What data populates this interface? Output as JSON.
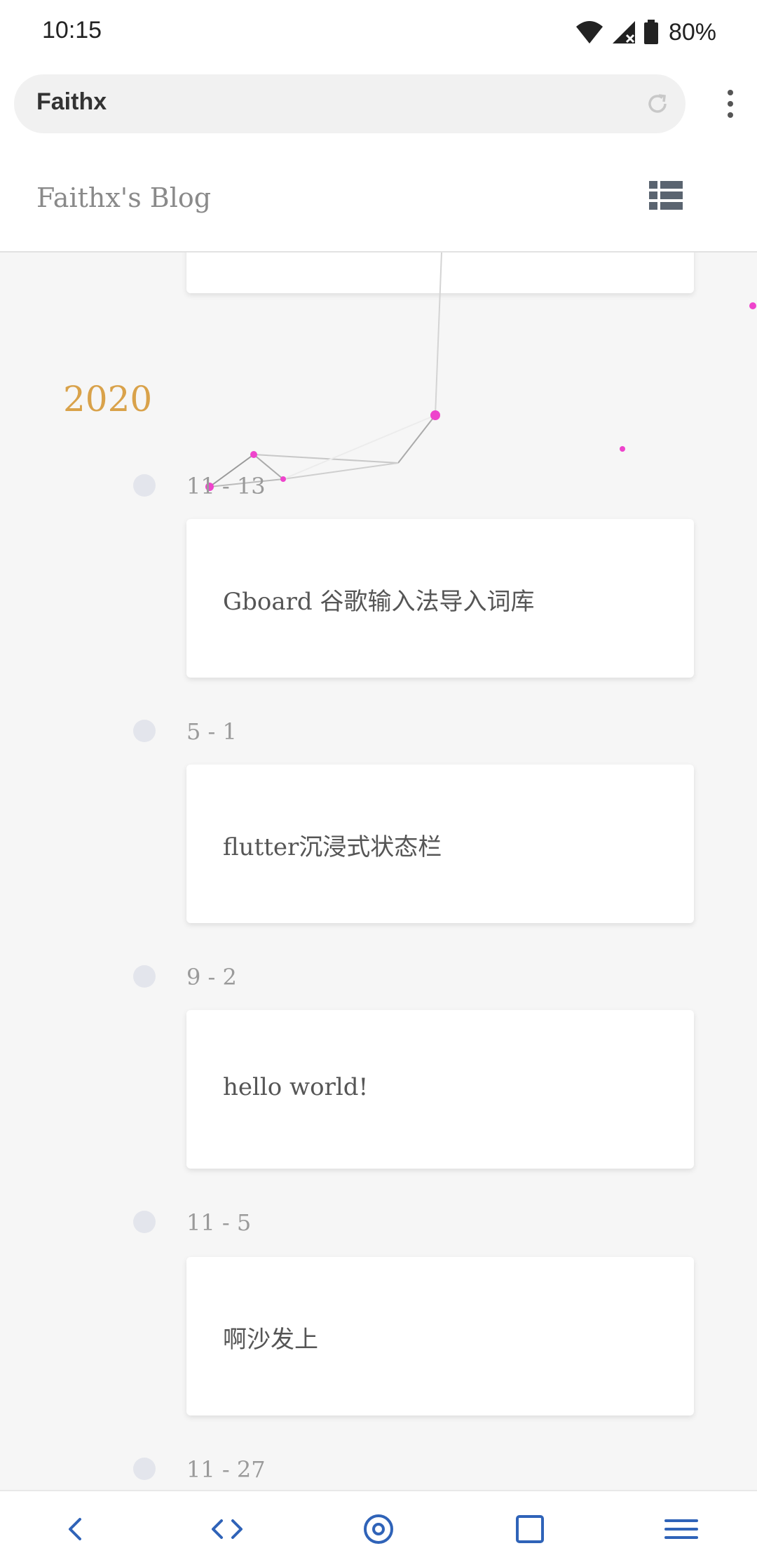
{
  "status_bar": {
    "time": "10:15",
    "battery_percent": "80%",
    "icons": [
      "wifi-icon",
      "signal-icon",
      "battery-icon"
    ]
  },
  "browser": {
    "url_title": "Faithx",
    "icons": [
      "reload-icon",
      "overflow-menu-icon"
    ]
  },
  "site": {
    "title": "Faithx's Blog",
    "menu_icon": "list-menu-icon"
  },
  "archive": {
    "year": "2020",
    "posts": [
      {
        "date": "11 - 13",
        "title": "Gboard 谷歌输入法导入词库"
      },
      {
        "date": "5 - 1",
        "title": "flutter沉浸式状态栏"
      },
      {
        "date": "9 - 2",
        "title": "hello world!"
      },
      {
        "date": "11 - 5",
        "title": "啊沙发上"
      },
      {
        "date": "11 - 27",
        "title": ""
      }
    ]
  },
  "nav_bar": {
    "icons": [
      "back-icon",
      "code-icon",
      "home-target-icon",
      "tabs-square-icon",
      "hamburger-menu-icon"
    ]
  },
  "colors": {
    "accent_year": "#d9a24a",
    "particle": "#ee44cc",
    "nav_icon": "#2f63b8"
  }
}
